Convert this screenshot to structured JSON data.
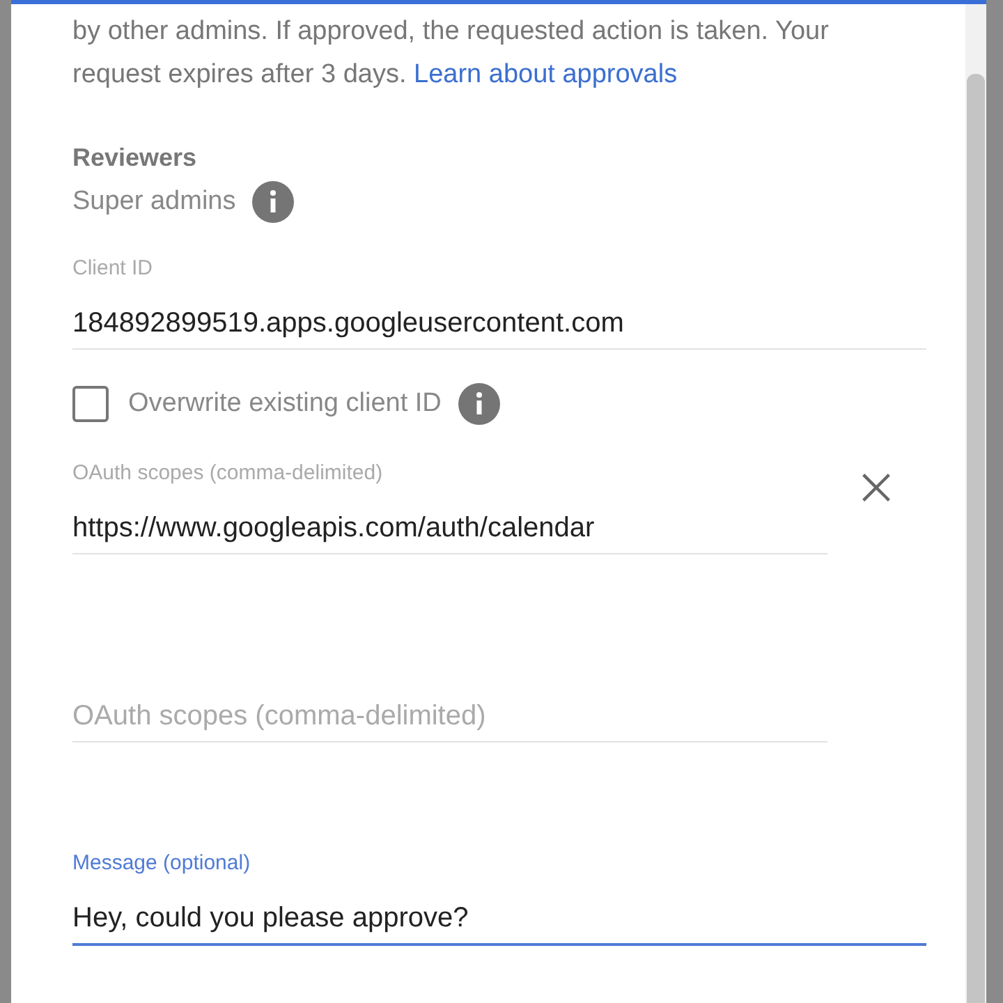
{
  "intro": {
    "text": "by other admins. If approved, the requested action is taken. Your request expires after 3 days.",
    "link": "Learn about approvals"
  },
  "reviewers": {
    "label": "Reviewers",
    "value": "Super admins"
  },
  "client_id": {
    "label": "Client ID",
    "value": "184892899519.apps.googleusercontent.com"
  },
  "overwrite": {
    "label": "Overwrite existing client ID",
    "checked": false
  },
  "scopes": [
    {
      "label": "OAuth scopes (comma-delimited)",
      "value": "https://www.googleapis.com/auth/calendar",
      "removable": true
    },
    {
      "placeholder": "OAuth scopes (comma-delimited)",
      "removable": false
    }
  ],
  "message": {
    "label": "Message (optional)",
    "value": "Hey, could you please approve?",
    "focused": true
  }
}
